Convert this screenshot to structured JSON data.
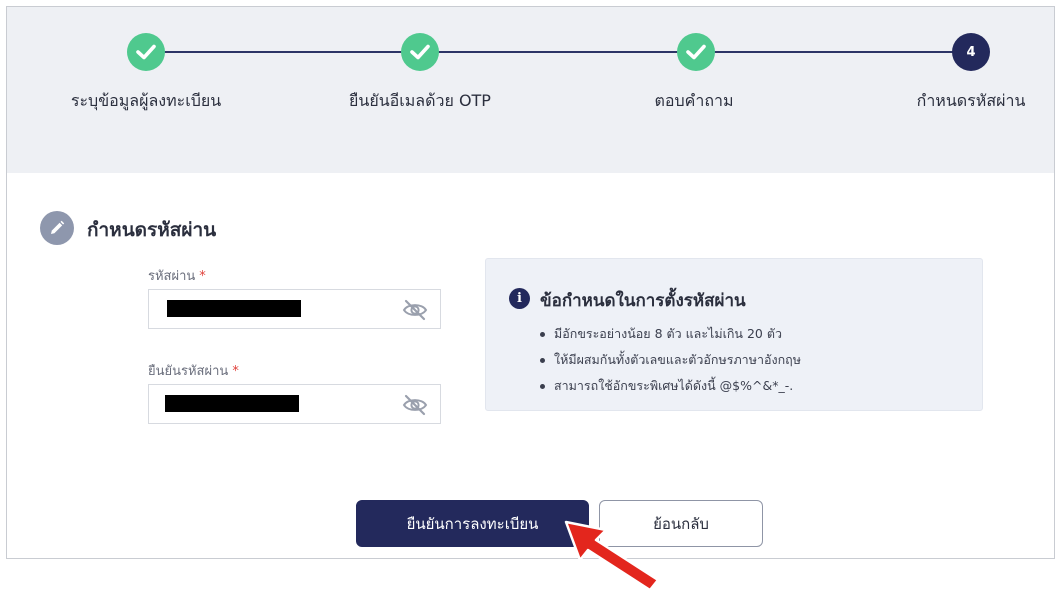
{
  "stepper": {
    "steps": [
      {
        "label": "ระบุข้อมูลผู้ลงทะเบียน",
        "status": "done"
      },
      {
        "label": "ยืนยันอีเมลด้วย OTP",
        "status": "done"
      },
      {
        "label": "ตอบคำถาม",
        "status": "done"
      },
      {
        "label": "กำหนดรหัสผ่าน",
        "status": "current",
        "number": "4"
      }
    ]
  },
  "section": {
    "title": "กำหนดรหัสผ่าน",
    "icon": "pencil-icon"
  },
  "form": {
    "password_label": "รหัสผ่าน",
    "confirm_label": "ยืนยันรหัสผ่าน",
    "required_mark": "*",
    "toggle_icon": "eye-off-icon"
  },
  "requirements": {
    "title": "ข้อกำหนดในการตั้งรหัสผ่าน",
    "items": [
      "มีอักขระอย่างน้อย 8 ตัว และไม่เกิน 20 ตัว",
      "ให้มีผสมกันทั้งตัวเลขและตัวอักษรภาษาอังกฤษ",
      "สามารถใช้อักขระพิเศษได้ดังนี้ @$%^&*_-."
    ]
  },
  "buttons": {
    "confirm": "ยืนยันการลงทะเบียน",
    "back": "ย้อนกลับ"
  },
  "colors": {
    "primary": "#23295c",
    "done": "#4fc98e",
    "annotation_arrow": "#e3261d"
  }
}
